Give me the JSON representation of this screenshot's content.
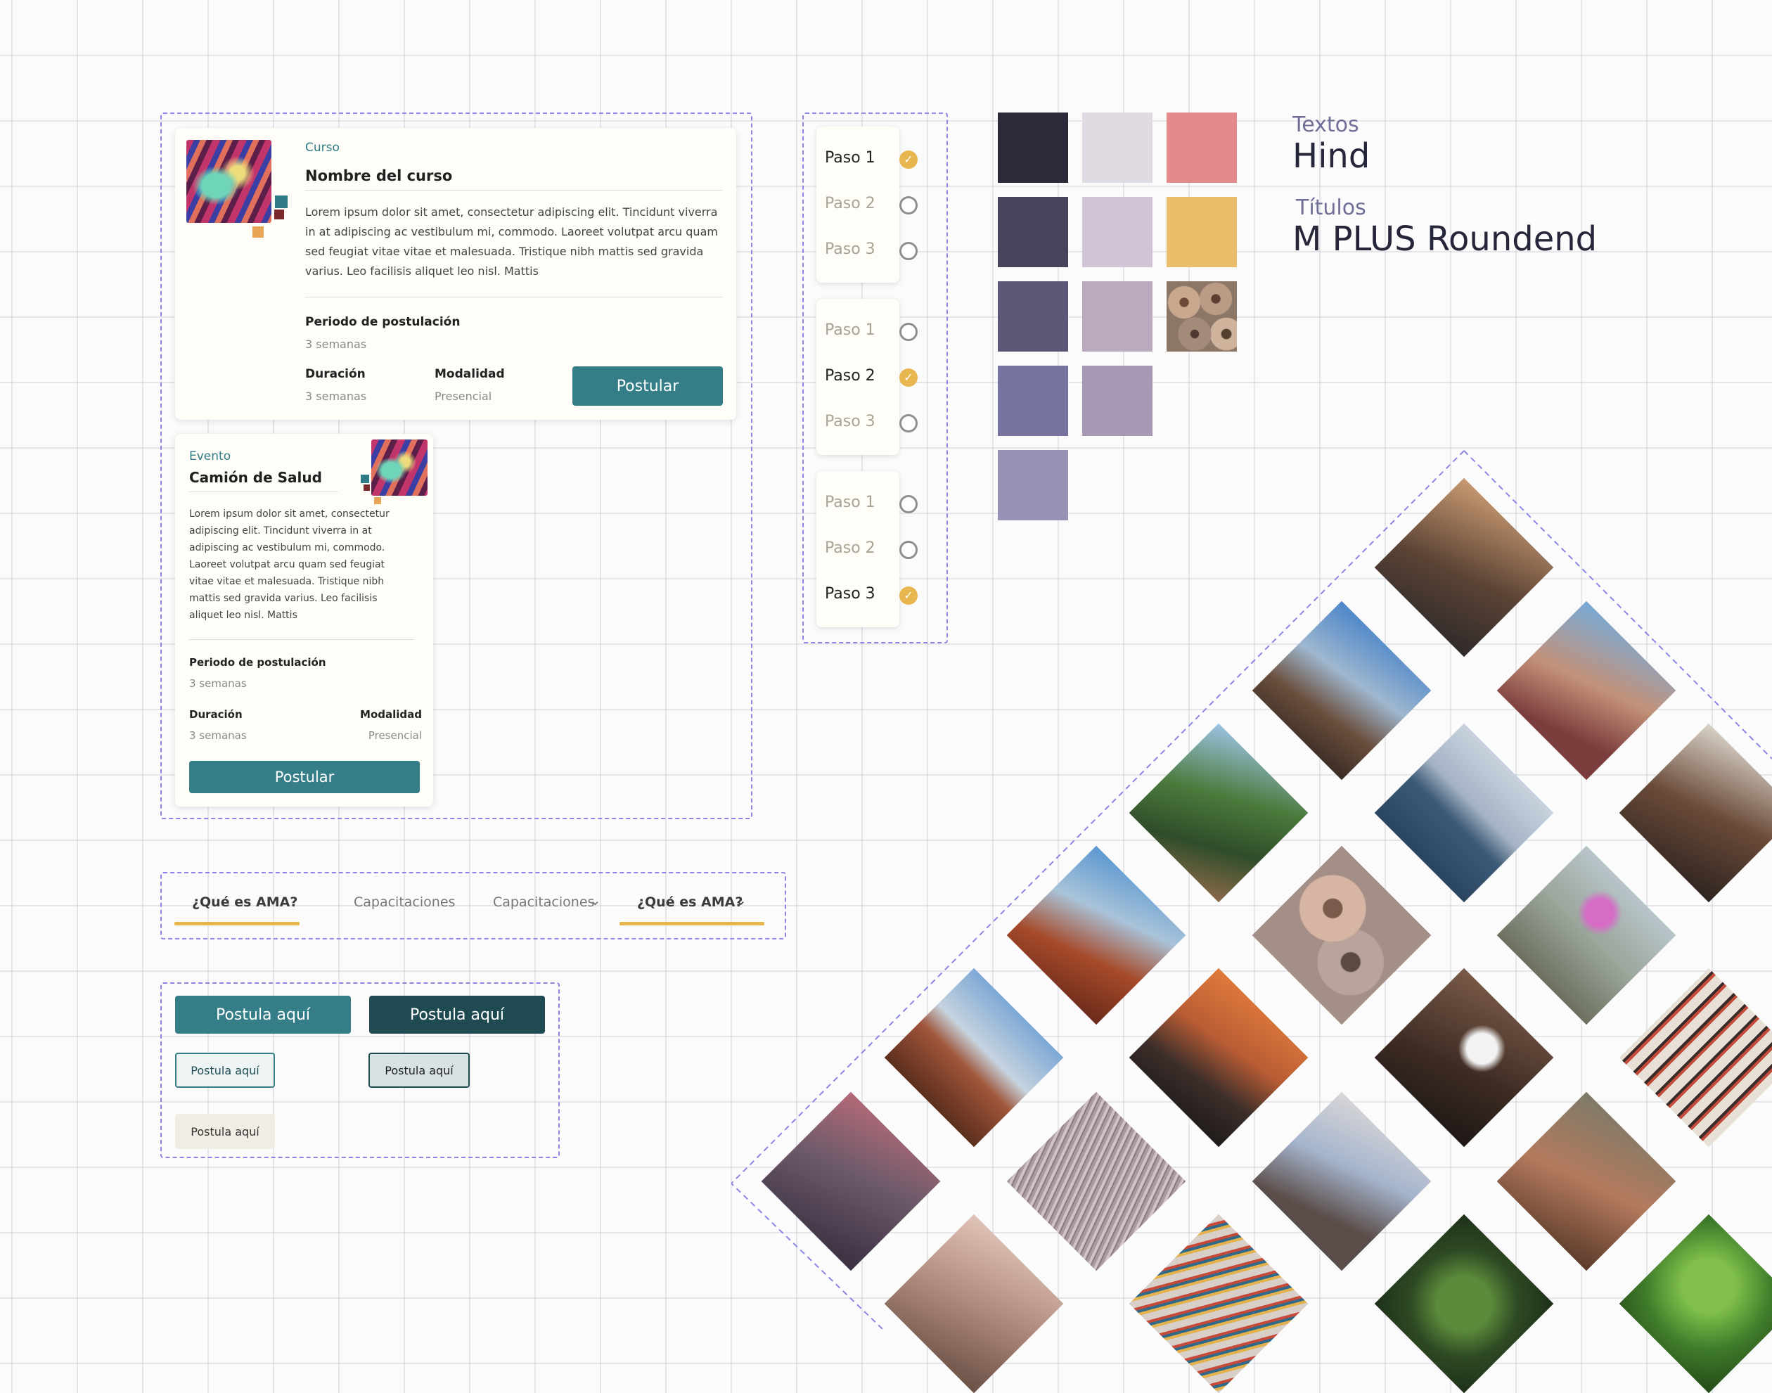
{
  "course_card": {
    "category": "Curso",
    "title": "Nombre del curso",
    "description": "Lorem ipsum dolor sit amet, consectetur adipiscing elit. Tincidunt viverra in at adipiscing ac vestibulum mi, commodo. Laoreet volutpat arcu quam sed feugiat vitae vitae et malesuada. Tristique nibh mattis sed gravida varius. Leo facilisis aliquet leo nisl. Mattis",
    "period_label": "Periodo de postulación",
    "period_value": "3 semanas",
    "duration_label": "Duración",
    "duration_value": "3 semanas",
    "mode_label": "Modalidad",
    "mode_value": "Presencial",
    "button_label": "Postular"
  },
  "event_card": {
    "category": "Evento",
    "title": "Camión de Salud",
    "description": "Lorem ipsum dolor sit amet, consectetur adipiscing elit. Tincidunt viverra in at adipiscing ac vestibulum mi, commodo. Laoreet volutpat arcu quam sed feugiat vitae vitae et malesuada. Tristique nibh mattis sed gravida varius. Leo facilisis aliquet leo nisl. Mattis",
    "period_label": "Periodo de postulación",
    "period_value": "3 semanas",
    "duration_label": "Duración",
    "duration_value": "3 semanas",
    "mode_label": "Modalidad",
    "mode_value": "Presencial",
    "button_label": "Postular"
  },
  "steppers": [
    {
      "active": 1,
      "steps": [
        "Paso 1",
        "Paso 2",
        "Paso 3"
      ]
    },
    {
      "active": 2,
      "steps": [
        "Paso 1",
        "Paso 2",
        "Paso 3"
      ]
    },
    {
      "active": 3,
      "steps": [
        "Paso 1",
        "Paso 2",
        "Paso 3"
      ]
    }
  ],
  "palette": {
    "col1": [
      "#2b2a3a",
      "#45445a",
      "#5a5777",
      "#77739f",
      "#9791b6"
    ],
    "col2": [
      "#e0dbe2",
      "#d1c4d6",
      "#bba9bf",
      "#a799b3"
    ],
    "col3": [
      "#e58a8c",
      "#e9bd69"
    ]
  },
  "typography": {
    "text_label": "Textos",
    "text_font": "Hind",
    "title_label": "Títulos",
    "title_font": "M PLUS Roundend"
  },
  "nav": {
    "items": [
      "¿Qué es AMA?",
      "Capacitaciones",
      "Capacitaciones",
      "¿Qué es AMA?"
    ],
    "accent": "#e9b64e"
  },
  "buttons": {
    "primary": "Postula aquí",
    "primary_dark": "Postula aquí",
    "outline": "Postula aquí",
    "outline_dark": "Postula aquí",
    "ghost": "Postula aquí"
  }
}
